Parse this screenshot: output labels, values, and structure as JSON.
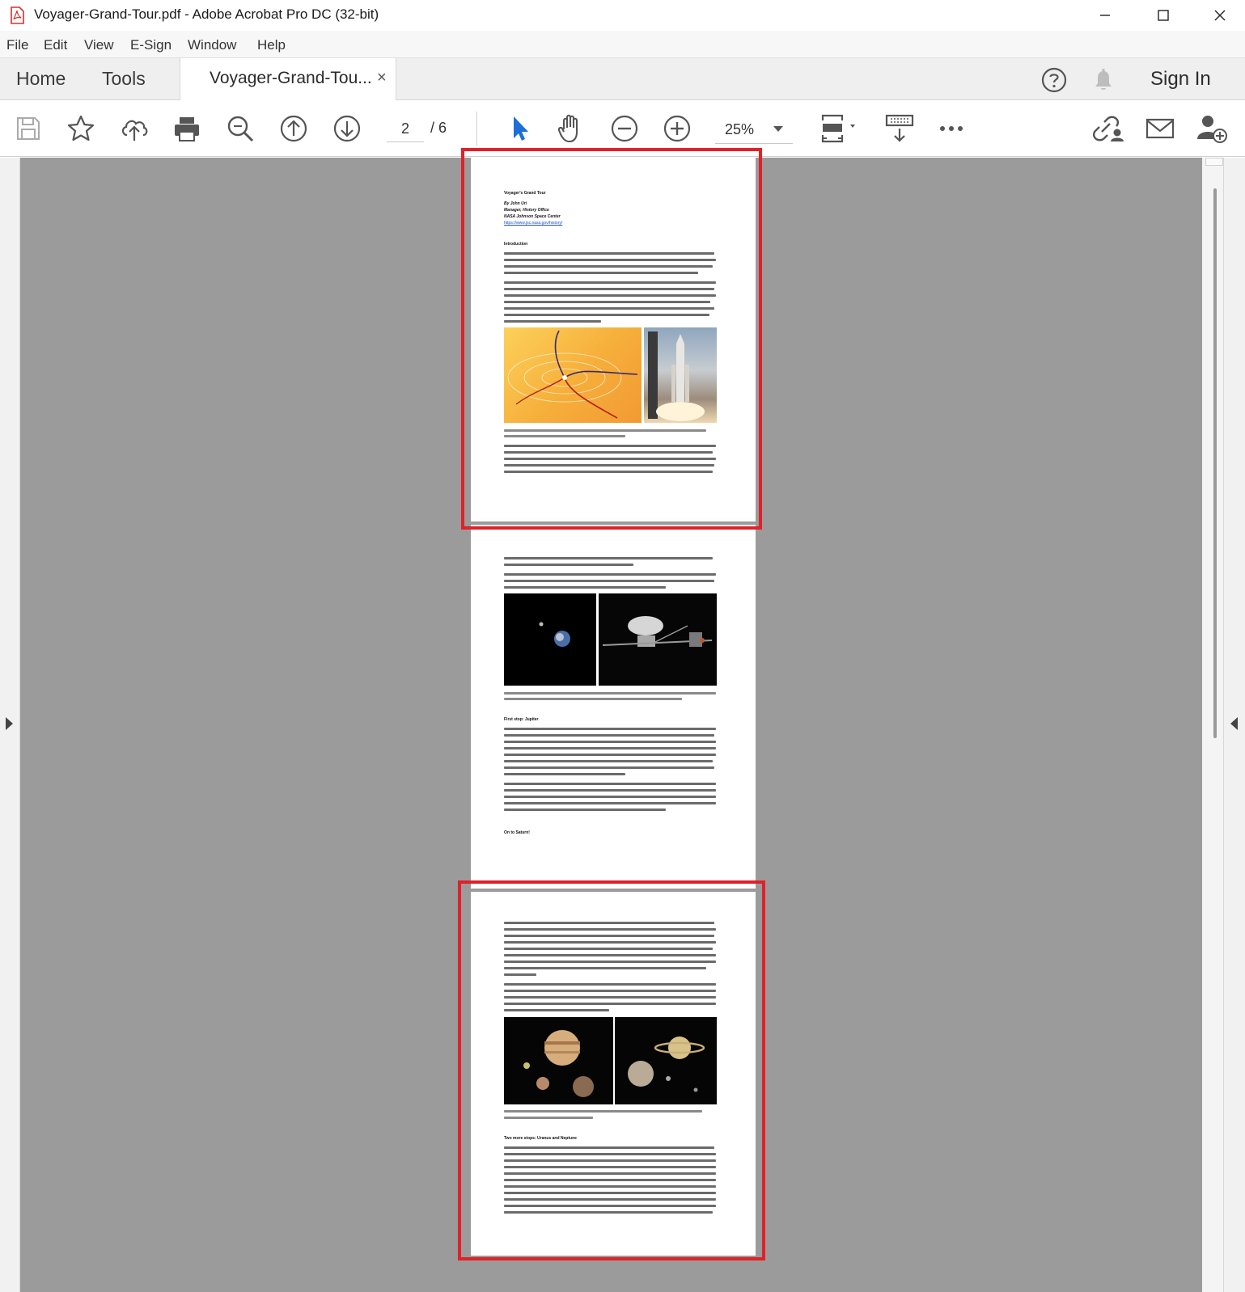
{
  "window": {
    "title": "Voyager-Grand-Tour.pdf - Adobe Acrobat Pro DC (32-bit)"
  },
  "menu": [
    "File",
    "Edit",
    "View",
    "E-Sign",
    "Window",
    "Help"
  ],
  "tabs": {
    "home": "Home",
    "tools": "Tools",
    "document": "Voyager-Grand-Tou...",
    "close": "×",
    "sign_in": "Sign In"
  },
  "toolbar": {
    "current_page": "2",
    "total_pages": "/ 6",
    "zoom": "25%"
  },
  "pages": {
    "p1": {
      "title": "Voyager's Grand Tour",
      "byline": "By John Uri",
      "role": "Manager, History Office",
      "org": "NASA Johnson Space Center",
      "url": "https://www.jsc.nasa.gov/history/",
      "intro_heading": "Introduction"
    },
    "p2": {
      "heading": "First stop: Jupiter",
      "heading2": "On to Saturn!"
    },
    "p3": {
      "heading": "Two more stops:  Uranus and Neptune"
    }
  },
  "colors": {
    "accent": "#e0212a",
    "workspace": "#9b9b9b",
    "select_tool": "#1d6fd8"
  }
}
